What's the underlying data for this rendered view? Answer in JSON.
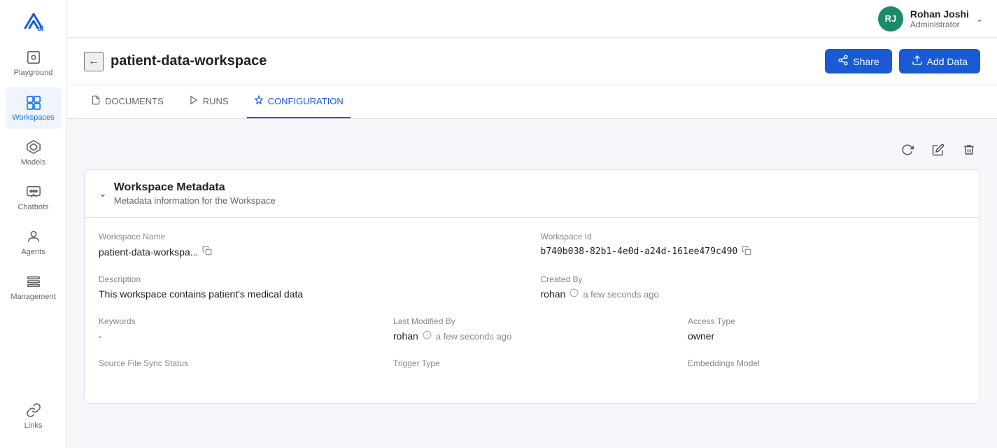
{
  "app": {
    "logo_alt": "ai-logo"
  },
  "topbar": {
    "user": {
      "initials": "RJ",
      "name": "Rohan Joshi",
      "role": "Administrator"
    }
  },
  "sidebar": {
    "items": [
      {
        "id": "playground",
        "label": "Playground",
        "active": false
      },
      {
        "id": "workspaces",
        "label": "Workspaces",
        "active": true
      },
      {
        "id": "models",
        "label": "Models",
        "active": false
      },
      {
        "id": "chatbots",
        "label": "Chatbots",
        "active": false
      },
      {
        "id": "agents",
        "label": "Agents",
        "active": false
      },
      {
        "id": "management",
        "label": "Management",
        "active": false
      },
      {
        "id": "links",
        "label": "Links",
        "active": false
      }
    ]
  },
  "header": {
    "back_label": "←",
    "title": "patient-data-workspace",
    "share_label": "Share",
    "add_data_label": "Add Data"
  },
  "tabs": [
    {
      "id": "documents",
      "label": "DOCUMENTS",
      "active": false
    },
    {
      "id": "runs",
      "label": "RUNS",
      "active": false
    },
    {
      "id": "configuration",
      "label": "CONFIGURATION",
      "active": true
    }
  ],
  "toolbar": {
    "refresh_title": "Refresh",
    "edit_title": "Edit",
    "delete_title": "Delete"
  },
  "metadata": {
    "section_title": "Workspace Metadata",
    "section_subtitle": "Metadata information for the Workspace",
    "workspace_name_label": "Workspace Name",
    "workspace_name_value": "patient-data-workspa...",
    "workspace_id_label": "Workspace Id",
    "workspace_id_value": "b740b038-82b1-4e0d-a24d-161ee479c490",
    "description_label": "Description",
    "description_value": "This workspace contains patient's medical data",
    "created_by_label": "Created By",
    "created_by_value": "rohan",
    "created_by_time": "a few seconds ago",
    "keywords_label": "Keywords",
    "keywords_value": "-",
    "last_modified_label": "Last Modified By",
    "last_modified_value": "rohan",
    "last_modified_time": "a few seconds ago",
    "access_type_label": "Access Type",
    "access_type_value": "owner",
    "source_file_label": "Source File Sync Status",
    "trigger_type_label": "Trigger Type",
    "embeddings_model_label": "Embeddings Model"
  }
}
